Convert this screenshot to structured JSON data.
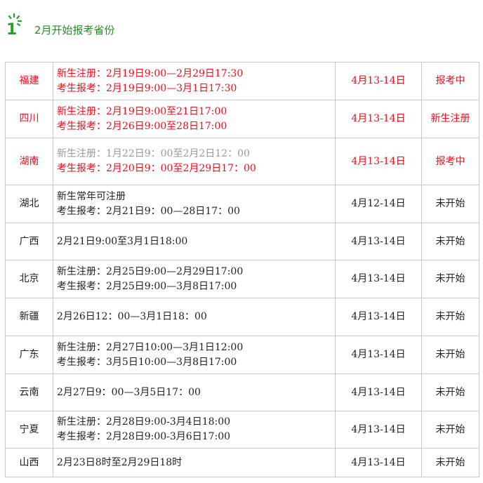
{
  "header": {
    "number": "1",
    "title": "2月开始报考省份"
  },
  "colors": {
    "accent_green": "#2a9d2a",
    "highlight_red": "#e8101a",
    "muted_grey": "#999999",
    "text_dark": "#222222"
  },
  "rows": [
    {
      "province": "福建",
      "lines": [
        {
          "text": "新生注册：2月19日9:00—2月29日17:30",
          "tone": "red"
        },
        {
          "text": "考生报考：2月19日9:00—3月1日17:30",
          "tone": "red"
        }
      ],
      "exam": "4月13-14日",
      "status": "报考中",
      "tone": "red"
    },
    {
      "province": "四川",
      "lines": [
        {
          "text": "新生注册：2月19日9:00至21日17:00",
          "tone": "red"
        },
        {
          "text": "考生报考：2月26日9:00至28日17:00",
          "tone": "red"
        }
      ],
      "exam": "4月13-14日",
      "status": "新生注册",
      "tone": "red"
    },
    {
      "province": "湖南",
      "lines": [
        {
          "text": "新生注册：1月22日9：00至2月2日12：00",
          "tone": "grey"
        },
        {
          "text": "考生报考：2月20日9：00至2月29日17：00",
          "tone": "red"
        }
      ],
      "exam": "4月13-14日",
      "status": "报考中",
      "tone": "red"
    },
    {
      "province": "湖北",
      "lines": [
        {
          "text": "新生常年可注册",
          "tone": "dark"
        },
        {
          "text": "考生报考：2月21日9：00—28日17：00",
          "tone": "dark"
        }
      ],
      "exam": "4月12-14日",
      "status": "未开始",
      "tone": "dark"
    },
    {
      "province": "广西",
      "lines": [
        {
          "text": "2月21日9:00至3月1日18:00",
          "tone": "dark"
        }
      ],
      "exam": "4月13-14日",
      "status": "未开始",
      "tone": "dark"
    },
    {
      "province": "北京",
      "lines": [
        {
          "text": "新生注册：2月25日9:00—2月29日17:00",
          "tone": "dark"
        },
        {
          "text": "考生报考：2月25日9:00—3月8日17:00",
          "tone": "dark"
        }
      ],
      "exam": "4月13-14日",
      "status": "未开始",
      "tone": "dark"
    },
    {
      "province": "新疆",
      "lines": [
        {
          "text": "2月26日12：00—3月1日18：00",
          "tone": "dark"
        }
      ],
      "exam": "4月13-14日",
      "status": "未开始",
      "tone": "dark"
    },
    {
      "province": "广东",
      "lines": [
        {
          "text": "新生注册：2月27日10:00—3月1日12:00",
          "tone": "dark"
        },
        {
          "text": "考生报考：3月5日10:00—3月8日17:00",
          "tone": "dark"
        }
      ],
      "exam": "4月13-14日",
      "status": "未开始",
      "tone": "dark"
    },
    {
      "province": "云南",
      "lines": [
        {
          "text": "2月27日9：00—3月5日17：00",
          "tone": "dark"
        }
      ],
      "exam": "4月13-14日",
      "status": "未开始",
      "tone": "dark"
    },
    {
      "province": "宁夏",
      "lines": [
        {
          "text": "新生注册：2月28日9:00-3月4日18:00",
          "tone": "dark"
        },
        {
          "text": "考生报考：2月28日9:00-3月6日17:00",
          "tone": "dark"
        }
      ],
      "exam": "4月13-14日",
      "status": "未开始",
      "tone": "dark"
    },
    {
      "province": "山西",
      "lines": [
        {
          "text": "2月23日8时至2月29日18时",
          "tone": "dark"
        }
      ],
      "exam": "4月13-14日",
      "status": "未开始",
      "tone": "dark"
    }
  ]
}
